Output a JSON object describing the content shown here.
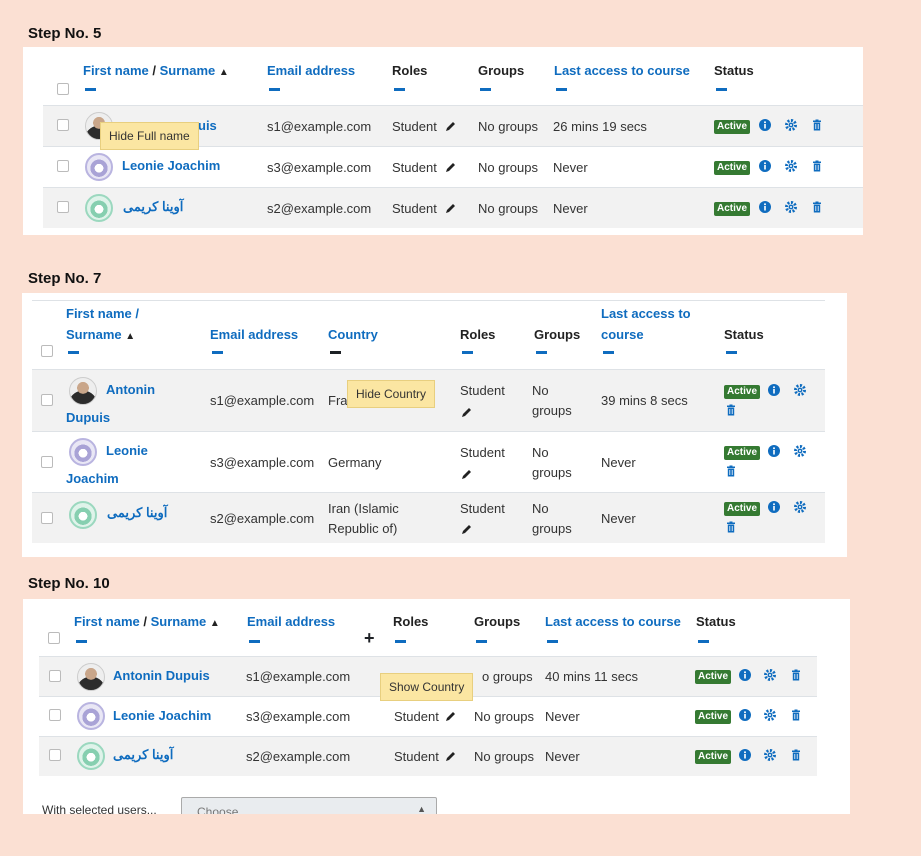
{
  "steps": [
    {
      "title": "Step No. 5",
      "headers": {
        "first_name": "First name",
        "slash": "/",
        "surname": "Surname",
        "sort_arrow": "▲",
        "email": "Email address",
        "roles": "Roles",
        "groups": "Groups",
        "last_access": "Last access to course",
        "status": "Status"
      },
      "tooltip": "Hide Full name",
      "rows": [
        {
          "name": "Antonin Dupuis",
          "name_visible_part": "uis",
          "email": "s1@example.com",
          "role": "Student",
          "groups": "No groups",
          "last_access": "26 mins 19 secs",
          "status": "Active"
        },
        {
          "name": "Leonie Joachim",
          "email": "s3@example.com",
          "role": "Student",
          "groups": "No groups",
          "last_access": "Never",
          "status": "Active"
        },
        {
          "name": "آوینا کریمی",
          "email": "s2@example.com",
          "role": "Student",
          "groups": "No groups",
          "last_access": "Never",
          "status": "Active"
        }
      ]
    },
    {
      "title": "Step No. 7",
      "headers": {
        "first_name": "First name /",
        "surname": "Surname",
        "sort_arrow": "▲",
        "email": "Email address",
        "country": "Country",
        "roles": "Roles",
        "groups": "Groups",
        "last_access_1": "Last access to",
        "last_access_2": "course",
        "status": "Status"
      },
      "tooltip": "Hide Country",
      "rows": [
        {
          "name_1": "Antonin",
          "name_2": "Dupuis",
          "email": "s1@example.com",
          "country": "Fra",
          "role": "Student",
          "groups_1": "No",
          "groups_2": "groups",
          "last_access": "39 mins 8 secs",
          "status": "Active"
        },
        {
          "name_1": "Leonie",
          "name_2": "Joachim",
          "email": "s3@example.com",
          "country": "Germany",
          "role": "Student",
          "groups_1": "No",
          "groups_2": "groups",
          "last_access": "Never",
          "status": "Active"
        },
        {
          "name_1": "آوینا کریمی",
          "email": "s2@example.com",
          "country_1": "Iran (Islamic",
          "country_2": "Republic of)",
          "role": "Student",
          "groups_1": "No",
          "groups_2": "groups",
          "last_access": "Never",
          "status": "Active"
        }
      ]
    },
    {
      "title": "Step No. 10",
      "headers": {
        "first_name": "First name",
        "slash": "/",
        "surname": "Surname",
        "sort_arrow": "▲",
        "email": "Email address",
        "plus": "+",
        "roles": "Roles",
        "groups": "Groups",
        "last_access": "Last access to course",
        "status": "Status"
      },
      "tooltip": "Show Country",
      "rows": [
        {
          "name": "Antonin Dupuis",
          "email": "s1@example.com",
          "role": "",
          "groups": "No groups",
          "groups_visible": "o groups",
          "last_access": "40 mins 11 secs",
          "status": "Active"
        },
        {
          "name": "Leonie Joachim",
          "email": "s3@example.com",
          "role": "Student",
          "groups": "No groups",
          "last_access": "Never",
          "status": "Active"
        },
        {
          "name": "آوینا کریمی",
          "email": "s2@example.com",
          "role": "Student",
          "groups": "No groups",
          "last_access": "Never",
          "status": "Active"
        }
      ],
      "bulk_label": "With selected users...",
      "bulk_placeholder": "Choose..."
    }
  ],
  "colors": {
    "link": "#0f6cbf",
    "active": "#357a32",
    "tooltip": "#fbe6a2",
    "background": "#fbe0d3"
  },
  "icons": [
    "pencil-icon",
    "info-icon",
    "gear-icon",
    "trash-icon",
    "sort-up-icon"
  ]
}
